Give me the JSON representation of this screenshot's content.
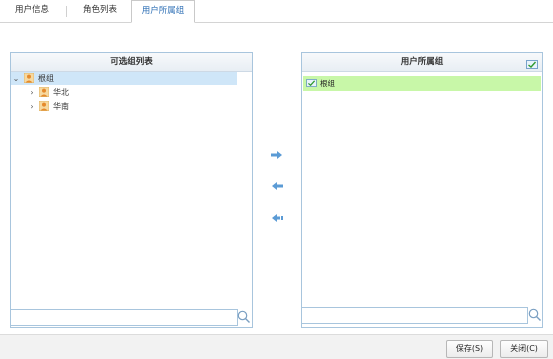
{
  "tabs": [
    {
      "label": "用户信息"
    },
    {
      "label": "角色列表"
    },
    {
      "label": "用户所属组"
    }
  ],
  "available_panel": {
    "title": "可选组列表",
    "tree": [
      {
        "label": "根组",
        "expanded": true,
        "selected": true
      },
      {
        "label": "华北",
        "expanded": false
      },
      {
        "label": "华南",
        "expanded": false
      }
    ],
    "search_value": ""
  },
  "assigned_panel": {
    "title": "用户所属组",
    "items": [
      {
        "label": "根组"
      }
    ],
    "search_value": ""
  },
  "arrows": [
    "move-right",
    "move-left",
    "move-all-left"
  ],
  "footer": {
    "save_label": "保存(S)",
    "close_label": "关闭(C)"
  },
  "colors": {
    "accent": "#2e6fb5",
    "arrow": "#5b9bd5",
    "selected_row": "#c8f7a8",
    "tree_selected": "#cfe6f8",
    "panel_border": "#a8c5dd"
  }
}
